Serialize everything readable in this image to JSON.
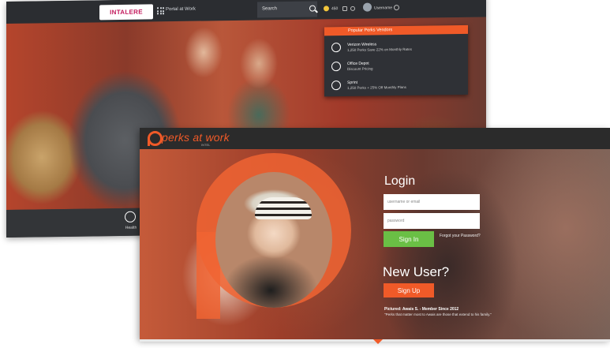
{
  "back_window": {
    "brand_logo": "INTALERE",
    "portal_menu": "Portal at Work",
    "search_label": "Search",
    "points": "450",
    "username": "Username",
    "dropdown": {
      "header": "Popular Perks Vendors",
      "items": [
        {
          "title": "Verizon Wireless",
          "subtitle": "1,250 Perks Save 22% on Monthly Rates"
        },
        {
          "title": "Office Depot",
          "subtitle": "Discount Pricing"
        },
        {
          "title": "Sprint",
          "subtitle": "1,250 Perks + 25% Off Monthly Plans"
        }
      ]
    },
    "footer_icon_label": "Health"
  },
  "front_window": {
    "logo_text": "perks at work",
    "logo_sub": "INTEL",
    "login": {
      "title": "Login",
      "username_placeholder": "username or email",
      "password_placeholder": "password",
      "signin_label": "Sign In",
      "forgot_label": "Forgot your Password?"
    },
    "signup": {
      "title": "New User?",
      "signup_label": "Sign Up"
    },
    "caption": {
      "line1": "Pictured: Awais S. - Member Since 2012",
      "line2": "\"Perks that matter most to Awais are those that extend to his family.\""
    }
  },
  "colors": {
    "accent": "#f05a28",
    "login_green": "#6abf45",
    "nav_dark": "#2b2d31"
  }
}
